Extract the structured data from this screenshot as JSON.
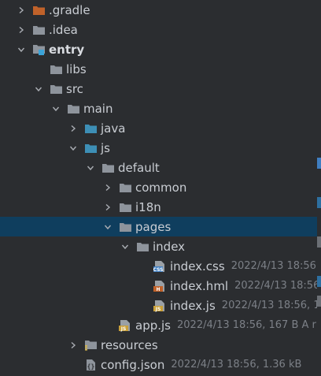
{
  "tree": {
    "rows": [
      {
        "label": ".gradle",
        "icon": "folder-orange-icon",
        "chevron": "right"
      },
      {
        "label": ".idea",
        "icon": "folder-icon",
        "chevron": "right"
      },
      {
        "label": "entry",
        "icon": "module-folder-icon",
        "chevron": "down",
        "bold": true
      },
      {
        "label": "libs",
        "icon": "folder-icon",
        "chevron": "none"
      },
      {
        "label": "src",
        "icon": "folder-icon",
        "chevron": "down"
      },
      {
        "label": "main",
        "icon": "folder-icon",
        "chevron": "down"
      },
      {
        "label": "java",
        "icon": "source-folder-icon",
        "chevron": "right"
      },
      {
        "label": "js",
        "icon": "source-folder-icon",
        "chevron": "down"
      },
      {
        "label": "default",
        "icon": "folder-icon",
        "chevron": "down"
      },
      {
        "label": "common",
        "icon": "folder-icon",
        "chevron": "right"
      },
      {
        "label": "i18n",
        "icon": "folder-icon",
        "chevron": "right"
      },
      {
        "label": "pages",
        "icon": "folder-icon",
        "chevron": "down",
        "selected": true
      },
      {
        "label": "index",
        "icon": "folder-icon",
        "chevron": "down"
      },
      {
        "label": "index.css",
        "icon": "css-file-icon",
        "chevron": "none",
        "meta": "2022/4/13 18:56"
      },
      {
        "label": "index.hml",
        "icon": "hml-file-icon",
        "chevron": "none",
        "meta": "2022/4/13 18:56"
      },
      {
        "label": "index.js",
        "icon": "js-file-icon",
        "chevron": "none",
        "meta": "2022/4/13 18:56, 1"
      },
      {
        "label": "app.js",
        "icon": "js-file-icon",
        "chevron": "none",
        "meta": "2022/4/13 18:56, 167 B A r"
      },
      {
        "label": "resources",
        "icon": "resources-folder-icon",
        "chevron": "right"
      },
      {
        "label": "config.json",
        "icon": "json-file-icon",
        "chevron": "none",
        "meta": "2022/4/13 18:56, 1.36 kB"
      }
    ]
  },
  "colors": {
    "background": "#2b2d30",
    "selected_row": "#0f3e5e",
    "folder": "#8e949c",
    "folder_orange": "#c0622a",
    "source_folder": "#3d8fb6",
    "module_badge": "#3ba3d8",
    "text": "#c9cdd3",
    "meta_text": "#7c8087",
    "css_badge": "#3f7ec1",
    "hml_badge": "#c0622a",
    "js_badge": "#c9a03a"
  }
}
